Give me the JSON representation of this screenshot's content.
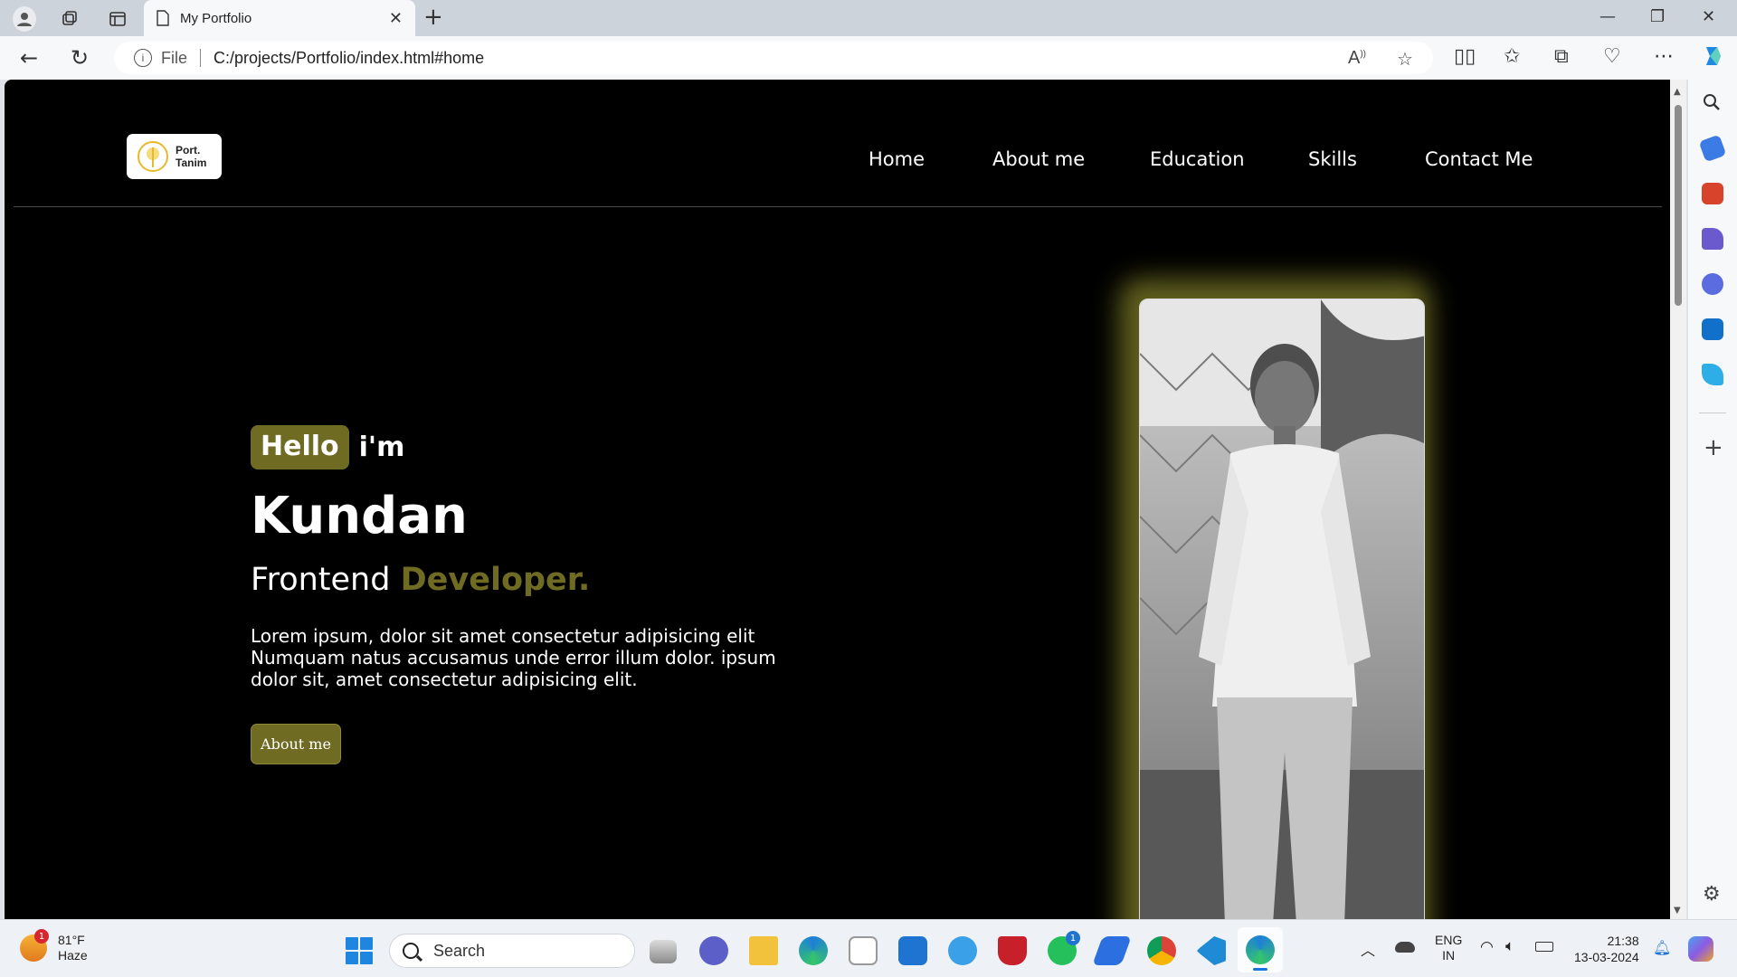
{
  "browser": {
    "tab_title": "My Portfolio",
    "address_scheme": "File",
    "address_url": "C:/projects/Portfolio/index.html#home"
  },
  "site": {
    "logo_line1": "Port.",
    "logo_line2": "Tanim",
    "nav": [
      "Home",
      "About me",
      "Education",
      "Skills",
      "Contact Me"
    ],
    "hello": "Hello",
    "im": "i'm",
    "name": "Kundan",
    "role_prefix": "Frontend",
    "role_accent": "Developer.",
    "description": "Lorem ipsum, dolor sit amet consectetur adipisicing elit Numquam natus accusamus unde error illum dolor. ipsum dolor sit, amet consectetur adipisicing elit.",
    "about_button": "About me",
    "accent_color": "#6f6b23"
  },
  "taskbar": {
    "weather_temp": "81°F",
    "weather_cond": "Haze",
    "weather_badge": "1",
    "search_label": "Search",
    "whatsapp_badge": "1",
    "lang_line1": "ENG",
    "lang_line2": "IN",
    "time": "21:38",
    "date": "13-03-2024"
  }
}
